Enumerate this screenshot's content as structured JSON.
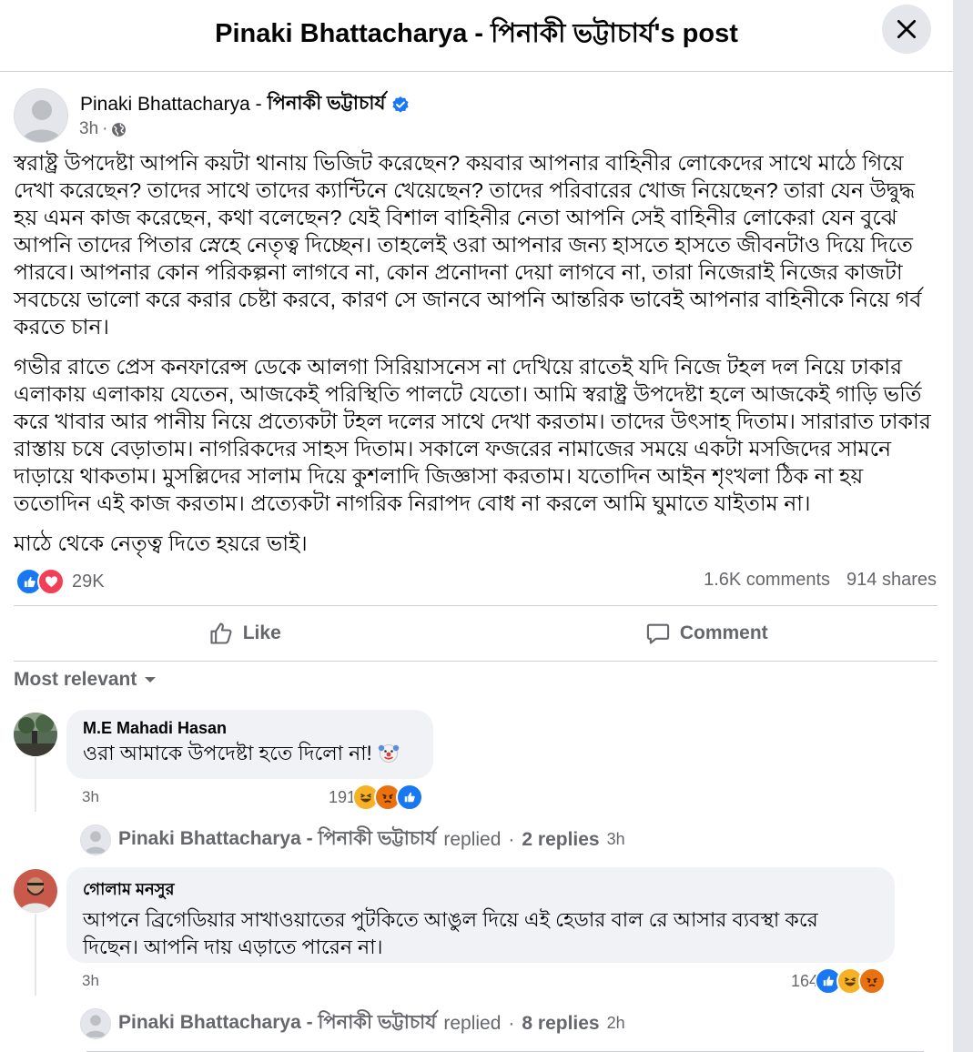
{
  "header": {
    "title": "Pinaki Bhattacharya - পিনাকী ভট্টাচার্য's post"
  },
  "post": {
    "author_latin": "Pinaki Bhattacharya - ",
    "author_bangla": "পিনাকী ভট্টাচার্য",
    "time": "3h",
    "separator": "·",
    "paragraphs": [
      "স্বরাষ্ট্র উপদেষ্টা আপনি কয়টা থানায় ভিজিট করেছেন? কয়বার আপনার বাহিনীর লোকেদের সাথে মাঠে গিয়ে দেখা করেছেন? তাদের সাথে তাদের ক্যান্টিনে খেয়েছেন? তাদের পরিবারের খোজ নিয়েছেন? তারা যেন উদ্বুদ্ধ হয় এমন কাজ করেছেন, কথা বলেছেন? যেই বিশাল বাহিনীর নেতা আপনি সেই বাহিনীর লোকেরা যেন বুঝে আপনি তাদের পিতার স্নেহে নেতৃত্ব দিচ্ছেন। তাহলেই ওরা আপনার জন্য হাসতে হাসতে জীবনটাও দিয়ে দিতে পারবে। আপনার কোন পরিকল্পনা লাগবে না, কোন প্রনোদনা দেয়া লাগবে না, তারা নিজেরাই নিজের কাজটা সবচেয়ে ভালো করে করার চেষ্টা করবে, কারণ সে জানবে আপনি আন্তরিক ভাবেই আপনার বাহিনীকে নিয়ে গর্ব করতে চান।",
      "গভীর রাতে প্রেস কনফারেন্স ডেকে আলগা সিরিয়াসনেস না দেখিয়ে রাতেই যদি নিজে টহল দল নিয়ে ঢাকার এলাকায় এলাকায় যেতেন, আজকেই পরিস্থিতি পালটে যেতো। আমি স্বরাষ্ট্র উপদেষ্টা হলে আজকেই গাড়ি ভর্তি করে খাবার আর পানীয় নিয়ে প্রত্যেকটা টহল দলের সাথে দেখা করতাম। তাদের উৎসাহ দিতাম। সারারাত ঢাকার রাস্তায় চষে বেড়াতাম। নাগরিকদের সাহস দিতাম। সকালে ফজরের নামাজের সময়ে একটা মসজিদের সামনে দাড়ায়ে থাকতাম। মুসল্লিদের সালাম দিয়ে কুশলাদি জিজ্ঞাসা করতাম। যতোদিন আইন শৃংখলা ঠিক না হয় ততোদিন এই কাজ করতাম। প্রত্যেকটা নাগরিক নিরাপদ বোধ না করলে আমি ঘুমাতে যাইতাম না।",
      "মাঠে থেকে নেতৃত্ব দিতে হয়রে ভাই।"
    ],
    "reactions_count": "29K",
    "comments_count": "1.6K comments",
    "shares_count": "914 shares"
  },
  "actions": {
    "like_label": "Like",
    "comment_label": "Comment"
  },
  "sort_label": "Most relevant",
  "comments": [
    {
      "author": "M.E Mahadi Hasan",
      "text": "ওরা আমাকে উপদেষ্টা হতে দিলো না!",
      "time": "3h",
      "reaction_count": "191",
      "reply_author": "Pinaki Bhattacharya - পিনাকী ভট্টাচার্য",
      "reply_verb": "replied",
      "reply_sep": "·",
      "reply_count": "2 replies",
      "reply_time": "3h"
    },
    {
      "author": "গোলাম মনসুর",
      "text": "আপনে ব্রিগেডিয়ার সাখাওয়াতের পুটকিতে আঙুল দিয়ে এই হেডার বাল রে আসার ব্যবস্থা করে দিছেন। আপনি দায় এড়াতে পারেন না।",
      "time": "3h",
      "reaction_count": "164",
      "reply_author": "Pinaki Bhattacharya - পিনাকী ভট্টাচার্য",
      "reply_verb": "replied",
      "reply_sep": "·",
      "reply_count": "8 replies",
      "reply_time": "2h"
    }
  ],
  "colors": {
    "like_blue": "#1877f2",
    "love_red": "#f33e58",
    "haha_yellow": "#f7b125",
    "angry_orange": "#e9710f",
    "secondary_text": "#65676b",
    "verified_blue": "#1877f2"
  },
  "icons": {
    "close": "close-icon",
    "globe": "globe-icon",
    "verified": "verified-badge-icon",
    "like": "like-thumb-icon",
    "comment": "comment-bubble-icon",
    "caret": "caret-down-icon"
  }
}
